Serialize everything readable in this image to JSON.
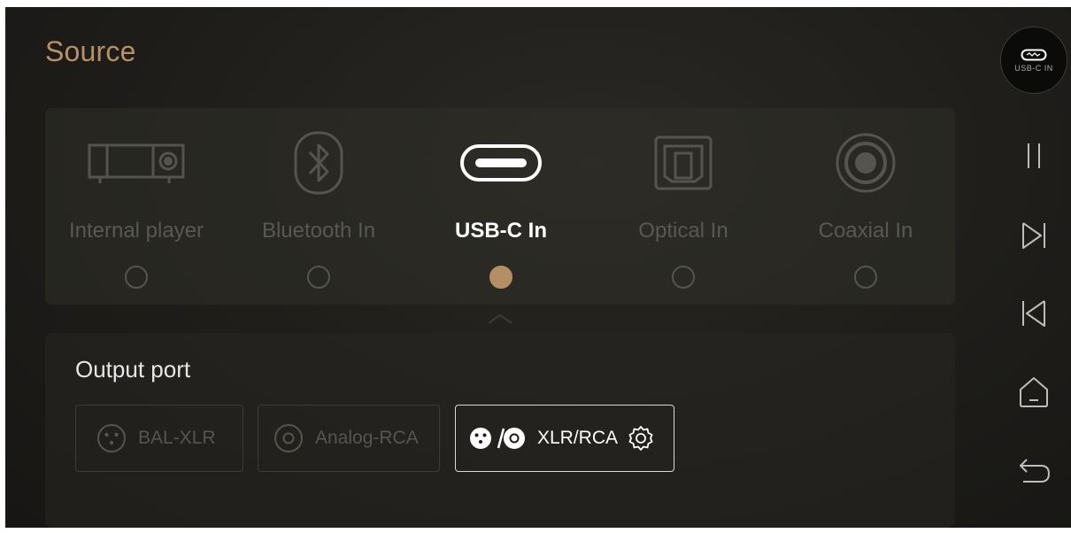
{
  "title": "Source",
  "sources": [
    {
      "label": "Internal player",
      "icon": "internal-player-icon",
      "selected": false
    },
    {
      "label": "Bluetooth In",
      "icon": "bluetooth-icon",
      "selected": false
    },
    {
      "label": "USB-C In",
      "icon": "usb-c-icon",
      "selected": true
    },
    {
      "label": "Optical In",
      "icon": "optical-icon",
      "selected": false
    },
    {
      "label": "Coaxial In",
      "icon": "coaxial-icon",
      "selected": false
    }
  ],
  "output": {
    "title": "Output port",
    "ports": [
      {
        "label": "BAL-XLR",
        "icon": "xlr-icon",
        "selected": false
      },
      {
        "label": "Analog-RCA",
        "icon": "rca-icon",
        "selected": false
      },
      {
        "label": "XLR/RCA",
        "icon": "xlr-rca-icon",
        "selected": true,
        "settings_icon": "gear-icon"
      }
    ]
  },
  "sidebar": {
    "badge_text": "USB-C IN",
    "controls": [
      "pause-icon",
      "next-track-icon",
      "previous-track-icon",
      "home-icon",
      "back-icon"
    ]
  },
  "colors": {
    "accent": "#b48e65",
    "title": "#b79068",
    "inactive": "#595851",
    "active": "#ffffff"
  }
}
